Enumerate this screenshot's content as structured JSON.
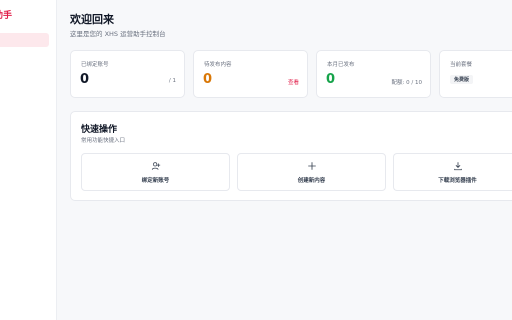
{
  "sidebar": {
    "brand": "助手"
  },
  "header": {
    "title": "欢迎回来",
    "subtitle": "这里是您的 XHS 运营助手控制台"
  },
  "stats": [
    {
      "label": "已绑定账号",
      "value": "0",
      "side": "/ 1",
      "color": "#111827"
    },
    {
      "label": "待发布内容",
      "value": "0",
      "side": "查看",
      "color": "#d97706",
      "side_color": "#e11d48"
    },
    {
      "label": "本月已发布",
      "value": "0",
      "side": "配额: 0 / 10",
      "color": "#16a34a"
    },
    {
      "label": "当前套餐",
      "badge": "免费版"
    }
  ],
  "quick": {
    "title": "快速操作",
    "subtitle": "常用功能快捷入口",
    "actions": [
      {
        "label": "绑定新账号",
        "icon": "user-plus-icon"
      },
      {
        "label": "创建新内容",
        "icon": "plus-icon"
      },
      {
        "label": "下载浏览器插件",
        "icon": "download-icon"
      }
    ]
  }
}
